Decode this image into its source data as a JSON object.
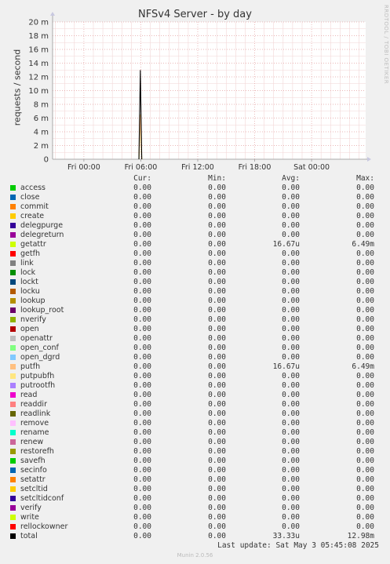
{
  "chart_data": {
    "type": "line",
    "title": "NFSv4 Server - by day",
    "ylabel": "requests / second",
    "ylim": [
      0,
      20
    ],
    "y_unit": "m",
    "y_ticks": [
      "0",
      "2 m",
      "4 m",
      "6 m",
      "8 m",
      "10 m",
      "12 m",
      "14 m",
      "16 m",
      "18 m",
      "20 m"
    ],
    "x_ticks": [
      "Fri 00:00",
      "Fri 06:00",
      "Fri 12:00",
      "Fri 18:00",
      "Sat 00:00"
    ],
    "x_range_hours": [
      -3.3,
      29.7
    ],
    "grid": true,
    "series": [
      {
        "name": "getattr",
        "color": "#ccff00",
        "x_hours": [
          5.8,
          5.95,
          6.1
        ],
        "values_m": [
          0,
          6.49,
          0
        ]
      },
      {
        "name": "putfh",
        "color": "#ffbc80",
        "x_hours": [
          5.8,
          5.95,
          6.1
        ],
        "values_m": [
          0,
          6.49,
          0
        ]
      },
      {
        "name": "total",
        "color": "#000000",
        "x_hours": [
          5.8,
          5.95,
          6.1
        ],
        "values_m": [
          0,
          12.98,
          0
        ]
      }
    ]
  },
  "side_credit": "RRDTOOL / TOBI OETIKER",
  "legend": {
    "headers": {
      "cur": "Cur:",
      "min": "Min:",
      "avg": "Avg:",
      "max": "Max:"
    },
    "rows": [
      {
        "name": "access",
        "color": "#00cc00",
        "cur": "0.00",
        "min": "0.00",
        "avg": "0.00",
        "max": "0.00"
      },
      {
        "name": "close",
        "color": "#0066b3",
        "cur": "0.00",
        "min": "0.00",
        "avg": "0.00",
        "max": "0.00"
      },
      {
        "name": "commit",
        "color": "#ff8000",
        "cur": "0.00",
        "min": "0.00",
        "avg": "0.00",
        "max": "0.00"
      },
      {
        "name": "create",
        "color": "#ffcc00",
        "cur": "0.00",
        "min": "0.00",
        "avg": "0.00",
        "max": "0.00"
      },
      {
        "name": "delegpurge",
        "color": "#330099",
        "cur": "0.00",
        "min": "0.00",
        "avg": "0.00",
        "max": "0.00"
      },
      {
        "name": "delegreturn",
        "color": "#990099",
        "cur": "0.00",
        "min": "0.00",
        "avg": "0.00",
        "max": "0.00"
      },
      {
        "name": "getattr",
        "color": "#ccff00",
        "cur": "0.00",
        "min": "0.00",
        "avg": "16.67u",
        "max": "6.49m"
      },
      {
        "name": "getfh",
        "color": "#ff0000",
        "cur": "0.00",
        "min": "0.00",
        "avg": "0.00",
        "max": "0.00"
      },
      {
        "name": "link",
        "color": "#808080",
        "cur": "0.00",
        "min": "0.00",
        "avg": "0.00",
        "max": "0.00"
      },
      {
        "name": "lock",
        "color": "#008f00",
        "cur": "0.00",
        "min": "0.00",
        "avg": "0.00",
        "max": "0.00"
      },
      {
        "name": "lockt",
        "color": "#00487d",
        "cur": "0.00",
        "min": "0.00",
        "avg": "0.00",
        "max": "0.00"
      },
      {
        "name": "locku",
        "color": "#b35a00",
        "cur": "0.00",
        "min": "0.00",
        "avg": "0.00",
        "max": "0.00"
      },
      {
        "name": "lookup",
        "color": "#b38f00",
        "cur": "0.00",
        "min": "0.00",
        "avg": "0.00",
        "max": "0.00"
      },
      {
        "name": "lookup_root",
        "color": "#6b006b",
        "cur": "0.00",
        "min": "0.00",
        "avg": "0.00",
        "max": "0.00"
      },
      {
        "name": "nverify",
        "color": "#8fb300",
        "cur": "0.00",
        "min": "0.00",
        "avg": "0.00",
        "max": "0.00"
      },
      {
        "name": "open",
        "color": "#b30000",
        "cur": "0.00",
        "min": "0.00",
        "avg": "0.00",
        "max": "0.00"
      },
      {
        "name": "openattr",
        "color": "#bebebe",
        "cur": "0.00",
        "min": "0.00",
        "avg": "0.00",
        "max": "0.00"
      },
      {
        "name": "open_conf",
        "color": "#80ff80",
        "cur": "0.00",
        "min": "0.00",
        "avg": "0.00",
        "max": "0.00"
      },
      {
        "name": "open_dgrd",
        "color": "#80c9ff",
        "cur": "0.00",
        "min": "0.00",
        "avg": "0.00",
        "max": "0.00"
      },
      {
        "name": "putfh",
        "color": "#ffc080",
        "cur": "0.00",
        "min": "0.00",
        "avg": "16.67u",
        "max": "6.49m"
      },
      {
        "name": "putpubfh",
        "color": "#ffe680",
        "cur": "0.00",
        "min": "0.00",
        "avg": "0.00",
        "max": "0.00"
      },
      {
        "name": "putrootfh",
        "color": "#aa80ff",
        "cur": "0.00",
        "min": "0.00",
        "avg": "0.00",
        "max": "0.00"
      },
      {
        "name": "read",
        "color": "#ee00cc",
        "cur": "0.00",
        "min": "0.00",
        "avg": "0.00",
        "max": "0.00"
      },
      {
        "name": "readdir",
        "color": "#ff8080",
        "cur": "0.00",
        "min": "0.00",
        "avg": "0.00",
        "max": "0.00"
      },
      {
        "name": "readlink",
        "color": "#666600",
        "cur": "0.00",
        "min": "0.00",
        "avg": "0.00",
        "max": "0.00"
      },
      {
        "name": "remove",
        "color": "#ffbfff",
        "cur": "0.00",
        "min": "0.00",
        "avg": "0.00",
        "max": "0.00"
      },
      {
        "name": "rename",
        "color": "#00ffcc",
        "cur": "0.00",
        "min": "0.00",
        "avg": "0.00",
        "max": "0.00"
      },
      {
        "name": "renew",
        "color": "#cc6699",
        "cur": "0.00",
        "min": "0.00",
        "avg": "0.00",
        "max": "0.00"
      },
      {
        "name": "restorefh",
        "color": "#999900",
        "cur": "0.00",
        "min": "0.00",
        "avg": "0.00",
        "max": "0.00"
      },
      {
        "name": "savefh",
        "color": "#00cc00",
        "cur": "0.00",
        "min": "0.00",
        "avg": "0.00",
        "max": "0.00"
      },
      {
        "name": "secinfo",
        "color": "#0066b3",
        "cur": "0.00",
        "min": "0.00",
        "avg": "0.00",
        "max": "0.00"
      },
      {
        "name": "setattr",
        "color": "#ff8000",
        "cur": "0.00",
        "min": "0.00",
        "avg": "0.00",
        "max": "0.00"
      },
      {
        "name": "setcltid",
        "color": "#ffcc00",
        "cur": "0.00",
        "min": "0.00",
        "avg": "0.00",
        "max": "0.00"
      },
      {
        "name": "setcltidconf",
        "color": "#330099",
        "cur": "0.00",
        "min": "0.00",
        "avg": "0.00",
        "max": "0.00"
      },
      {
        "name": "verify",
        "color": "#990099",
        "cur": "0.00",
        "min": "0.00",
        "avg": "0.00",
        "max": "0.00"
      },
      {
        "name": "write",
        "color": "#ccff00",
        "cur": "0.00",
        "min": "0.00",
        "avg": "0.00",
        "max": "0.00"
      },
      {
        "name": "rellockowner",
        "color": "#ff0000",
        "cur": "0.00",
        "min": "0.00",
        "avg": "0.00",
        "max": "0.00"
      },
      {
        "name": "total",
        "color": "#000000",
        "cur": "0.00",
        "min": "0.00",
        "avg": "33.33u",
        "max": "12.98m"
      }
    ]
  },
  "last_update": "Last update: Sat May  3 05:45:08 2025",
  "footer": "Munin 2.0.56"
}
